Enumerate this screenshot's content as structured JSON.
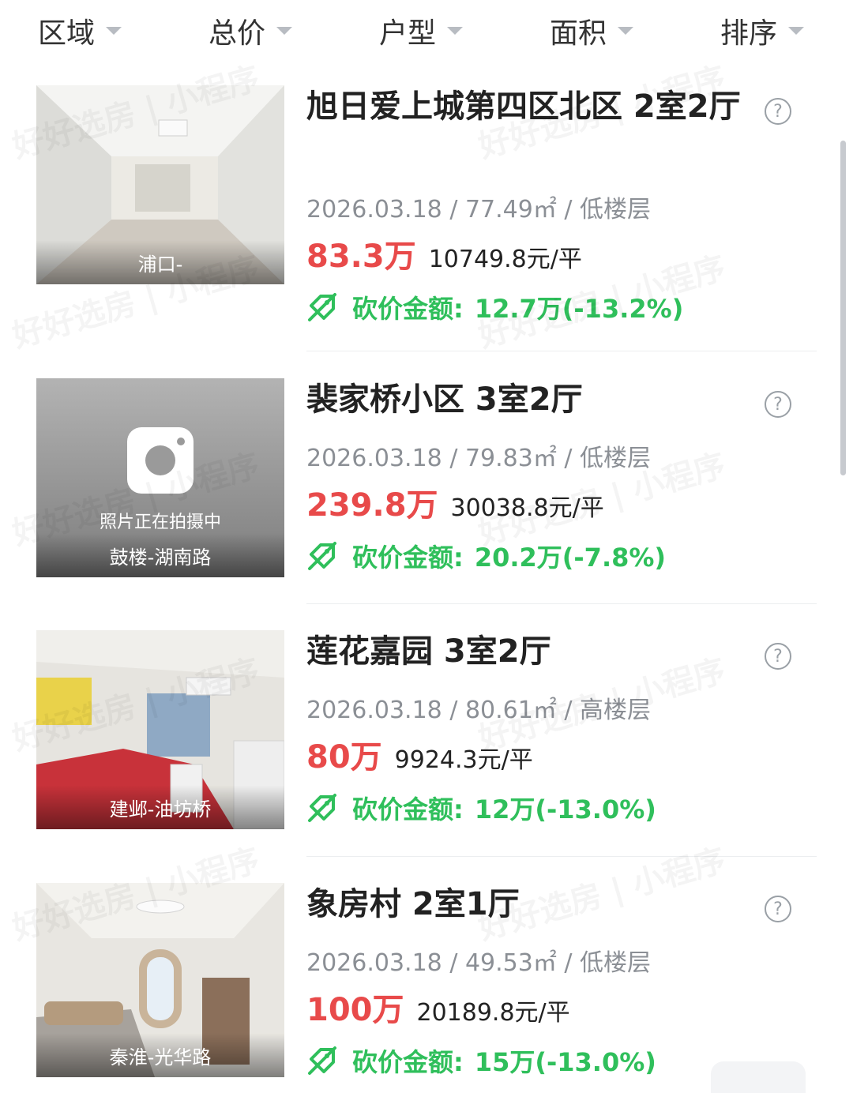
{
  "filters": [
    "区域",
    "总价",
    "户型",
    "面积",
    "排序"
  ],
  "listings": [
    {
      "title": "旭日爱上城第四区北区 2室2厅",
      "date": "2026.03.18",
      "area": "77.49㎡",
      "floor": "低楼层",
      "price": "83.3万",
      "unit_price": "10749.8元/平",
      "cut_label": "砍价金额:",
      "cut_value": "12.7万(-13.2%)",
      "location": "浦口-",
      "photo_note": ""
    },
    {
      "title": "裴家桥小区 3室2厅",
      "date": "2026.03.18",
      "area": "79.83㎡",
      "floor": "低楼层",
      "price": "239.8万",
      "unit_price": "30038.8元/平",
      "cut_label": "砍价金额:",
      "cut_value": "20.2万(-7.8%)",
      "location": "鼓楼-湖南路",
      "photo_note": "照片正在拍摄中"
    },
    {
      "title": "莲花嘉园 3室2厅",
      "date": "2026.03.18",
      "area": "80.61㎡",
      "floor": "高楼层",
      "price": "80万",
      "unit_price": "9924.3元/平",
      "cut_label": "砍价金额:",
      "cut_value": "12万(-13.0%)",
      "location": "建邺-油坊桥",
      "photo_note": ""
    },
    {
      "title": "象房村 2室1厅",
      "date": "2026.03.18",
      "area": "49.53㎡",
      "floor": "低楼层",
      "price": "100万",
      "unit_price": "20189.8元/平",
      "cut_label": "砍价金额:",
      "cut_value": "15万(-13.0%)",
      "location": "秦淮-光华路",
      "photo_note": ""
    }
  ],
  "watermark": "好好选房 | 小程序",
  "help_icon": "?",
  "colors": {
    "price": "#e84a4a",
    "cut": "#2fbf5b",
    "meta": "#8b8f95"
  }
}
